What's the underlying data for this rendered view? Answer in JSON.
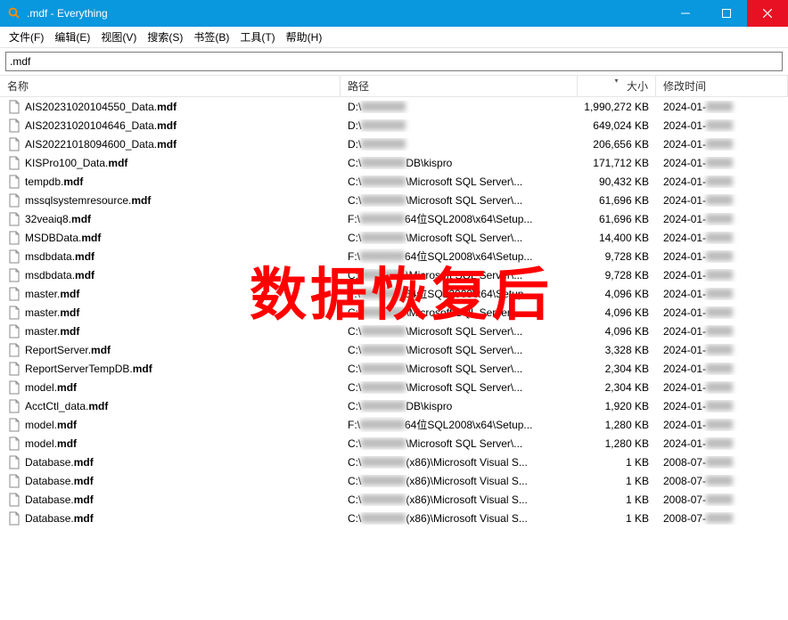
{
  "window": {
    "title": ".mdf - Everything"
  },
  "menu": {
    "file": "文件(F)",
    "edit": "编辑(E)",
    "view": "视图(V)",
    "search": "搜索(S)",
    "bookmark": "书签(B)",
    "tools": "工具(T)",
    "help": "帮助(H)"
  },
  "search": {
    "value": ".mdf"
  },
  "columns": {
    "name": "名称",
    "path": "路径",
    "size": "大小",
    "date": "修改时间"
  },
  "overlay": "数据恢复后",
  "files": [
    {
      "name_pre": "AIS20231020104550_Data.",
      "name_bold": "mdf",
      "drive": "D:\\",
      "path_suffix": "",
      "size": "1,990,272 KB",
      "date": "2024-01-"
    },
    {
      "name_pre": "AIS20231020104646_Data.",
      "name_bold": "mdf",
      "drive": "D:\\",
      "path_suffix": "",
      "size": "649,024 KB",
      "date": "2024-01-"
    },
    {
      "name_pre": "AIS20221018094600_Data.",
      "name_bold": "mdf",
      "drive": "D:\\",
      "path_suffix": "",
      "size": "206,656 KB",
      "date": "2024-01-"
    },
    {
      "name_pre": "KISPro100_Data.",
      "name_bold": "mdf",
      "drive": "C:\\",
      "path_suffix": "DB\\kispro",
      "size": "171,712 KB",
      "date": "2024-01-"
    },
    {
      "name_pre": "tempdb.",
      "name_bold": "mdf",
      "drive": "C:\\",
      "path_suffix": "\\Microsoft SQL Server\\...",
      "size": "90,432 KB",
      "date": "2024-01-"
    },
    {
      "name_pre": "mssqlsystemresource.",
      "name_bold": "mdf",
      "drive": "C:\\",
      "path_suffix": "\\Microsoft SQL Server\\...",
      "size": "61,696 KB",
      "date": "2024-01-"
    },
    {
      "name_pre": "32veaiq8.",
      "name_bold": "mdf",
      "drive": "F:\\",
      "path_suffix": "64位SQL2008\\x64\\Setup...",
      "size": "61,696 KB",
      "date": "2024-01-"
    },
    {
      "name_pre": "MSDBData.",
      "name_bold": "mdf",
      "drive": "C:\\",
      "path_suffix": "\\Microsoft SQL Server\\...",
      "size": "14,400 KB",
      "date": "2024-01-"
    },
    {
      "name_pre": "msdbdata.",
      "name_bold": "mdf",
      "drive": "F:\\",
      "path_suffix": "64位SQL2008\\x64\\Setup...",
      "size": "9,728 KB",
      "date": "2024-01-"
    },
    {
      "name_pre": "msdbdata.",
      "name_bold": "mdf",
      "drive": "C:\\",
      "path_suffix": "\\Microsoft SQL Server\\...",
      "size": "9,728 KB",
      "date": "2024-01-"
    },
    {
      "name_pre": "master.",
      "name_bold": "mdf",
      "drive": "F:\\",
      "path_suffix": "64位SQL2008\\x64\\Setup...",
      "size": "4,096 KB",
      "date": "2024-01-"
    },
    {
      "name_pre": "master.",
      "name_bold": "mdf",
      "drive": "C:\\",
      "path_suffix": "\\Microsoft SQL Server\\...",
      "size": "4,096 KB",
      "date": "2024-01-"
    },
    {
      "name_pre": "master.",
      "name_bold": "mdf",
      "drive": "C:\\",
      "path_suffix": "\\Microsoft SQL Server\\...",
      "size": "4,096 KB",
      "date": "2024-01-"
    },
    {
      "name_pre": "ReportServer.",
      "name_bold": "mdf",
      "drive": "C:\\",
      "path_suffix": "\\Microsoft SQL Server\\...",
      "size": "3,328 KB",
      "date": "2024-01-"
    },
    {
      "name_pre": "ReportServerTempDB.",
      "name_bold": "mdf",
      "drive": "C:\\",
      "path_suffix": "\\Microsoft SQL Server\\...",
      "size": "2,304 KB",
      "date": "2024-01-"
    },
    {
      "name_pre": "model.",
      "name_bold": "mdf",
      "drive": "C:\\",
      "path_suffix": "\\Microsoft SQL Server\\...",
      "size": "2,304 KB",
      "date": "2024-01-"
    },
    {
      "name_pre": "AcctCtl_data.",
      "name_bold": "mdf",
      "drive": "C:\\",
      "path_suffix": "DB\\kispro",
      "size": "1,920 KB",
      "date": "2024-01-"
    },
    {
      "name_pre": "model.",
      "name_bold": "mdf",
      "drive": "F:\\",
      "path_suffix": "64位SQL2008\\x64\\Setup...",
      "size": "1,280 KB",
      "date": "2024-01-"
    },
    {
      "name_pre": "model.",
      "name_bold": "mdf",
      "drive": "C:\\",
      "path_suffix": "\\Microsoft SQL Server\\...",
      "size": "1,280 KB",
      "date": "2024-01-"
    },
    {
      "name_pre": "Database.",
      "name_bold": "mdf",
      "drive": "C:\\",
      "path_suffix": " (x86)\\Microsoft Visual S...",
      "size": "1 KB",
      "date": "2008-07-"
    },
    {
      "name_pre": "Database.",
      "name_bold": "mdf",
      "drive": "C:\\",
      "path_suffix": " (x86)\\Microsoft Visual S...",
      "size": "1 KB",
      "date": "2008-07-"
    },
    {
      "name_pre": "Database.",
      "name_bold": "mdf",
      "drive": "C:\\",
      "path_suffix": " (x86)\\Microsoft Visual S...",
      "size": "1 KB",
      "date": "2008-07-"
    },
    {
      "name_pre": "Database.",
      "name_bold": "mdf",
      "drive": "C:\\",
      "path_suffix": " (x86)\\Microsoft Visual S...",
      "size": "1 KB",
      "date": "2008-07-"
    }
  ]
}
